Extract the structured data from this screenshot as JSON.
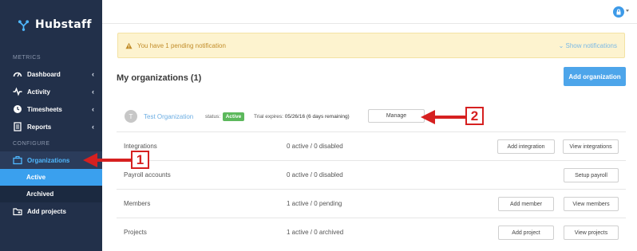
{
  "sidebar": {
    "brand": "Hubstaff",
    "metrics_label": "METRICS",
    "configure_label": "CONFIGURE",
    "items": [
      {
        "label": "Dashboard",
        "icon": "dashboard-icon"
      },
      {
        "label": "Activity",
        "icon": "activity-icon"
      },
      {
        "label": "Timesheets",
        "icon": "clock-icon"
      },
      {
        "label": "Reports",
        "icon": "document-icon"
      },
      {
        "label": "Organizations",
        "icon": "briefcase-icon"
      },
      {
        "label": "Add projects",
        "icon": "folder-plus-icon"
      }
    ],
    "subitems": [
      {
        "label": "Active"
      },
      {
        "label": "Archived"
      }
    ]
  },
  "notification": {
    "text": "You have 1 pending notification",
    "show_label": "Show notifications"
  },
  "main": {
    "title": "My organizations (1)",
    "add_org_label": "Add organization"
  },
  "org": {
    "initial": "T",
    "name": "Test Organization",
    "status_label": "status:",
    "status": "Active",
    "trial_label": "Trial expires:",
    "trial_date": "05/26/16 (6 days remaining)",
    "manage_label": "Manage"
  },
  "rows": [
    {
      "label": "Integrations",
      "value": "0 active / 0 disabled",
      "btn1": "Add integration",
      "btn2": "View integrations"
    },
    {
      "label": "Payroll accounts",
      "value": "0 active / 0 disabled",
      "btn2": "Setup payroll"
    },
    {
      "label": "Members",
      "value": "1 active / 0 pending",
      "btn1": "Add member",
      "btn2": "View members"
    },
    {
      "label": "Projects",
      "value": "1 active / 0 archived",
      "btn1": "Add project",
      "btn2": "View projects"
    }
  ],
  "annotations": {
    "one": "1",
    "two": "2",
    "color": "#d62020"
  },
  "colors": {
    "sidebar_bg": "#22304a",
    "accent": "#4da5ea",
    "active_badge": "#5cb85c"
  }
}
